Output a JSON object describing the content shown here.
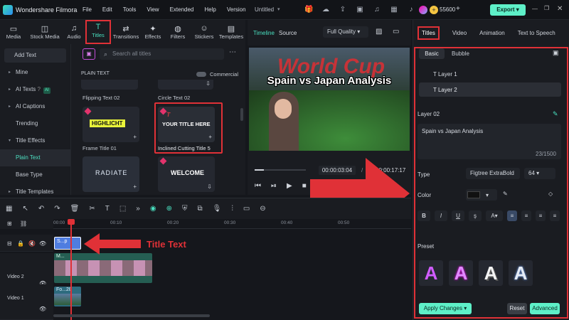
{
  "app": {
    "name": "Wondershare Filmora",
    "project": "Untitled",
    "credits": "55600",
    "export_label": "Export"
  },
  "menu": [
    "File",
    "Edit",
    "Tools",
    "View",
    "Extended",
    "Help",
    "Version"
  ],
  "toolbar": {
    "items": [
      {
        "label": "Media",
        "icon": "media-icon"
      },
      {
        "label": "Stock Media",
        "icon": "stock-media-icon"
      },
      {
        "label": "Audio",
        "icon": "audio-icon"
      },
      {
        "label": "Titles",
        "icon": "titles-icon"
      },
      {
        "label": "Transitions",
        "icon": "transitions-icon"
      },
      {
        "label": "Effects",
        "icon": "effects-icon"
      },
      {
        "label": "Filters",
        "icon": "filters-icon"
      },
      {
        "label": "Stickers",
        "icon": "stickers-icon"
      },
      {
        "label": "Templates",
        "icon": "templates-icon"
      }
    ]
  },
  "leftnav": {
    "add_text": "Add Text",
    "items": [
      "Mine",
      "AI Texts",
      "AI Captions",
      "Trending",
      "Title Effects",
      "Plain Text",
      "Base Type",
      "Title Templates"
    ],
    "ai_badge": "AI"
  },
  "grid": {
    "search_placeholder": "Search all titles",
    "section": "PLAIN TEXT",
    "commercial": "Commercial",
    "row0": [
      "Flipping Text 02",
      "Circle Text 02"
    ],
    "cards": [
      {
        "thumb": "HIGHLICHT",
        "label": "Frame Title 01"
      },
      {
        "thumb": "YOUR TITLE HERE",
        "label": "Inclined Cutting Title 5"
      },
      {
        "thumb": "RADIATE",
        "label": ""
      },
      {
        "thumb": "WELCOME",
        "label": ""
      }
    ]
  },
  "preview": {
    "tabs": [
      "Timeline",
      "Source"
    ],
    "quality": "Full Quality",
    "overlay_text": "Spain vs Japan Analysis",
    "time_current": "00:00:03:04",
    "time_total": "00:00:17:17",
    "progress": 0.18,
    "bg_text": "World Cup"
  },
  "right": {
    "tabs": [
      "Titles",
      "Video",
      "Animation",
      "Text to Speech"
    ],
    "subtabs": [
      "Basic",
      "Bubble"
    ],
    "layers": [
      "Layer 1",
      "Layer 2"
    ],
    "layer_label": "Layer 02",
    "text_value": "Spain vs Japan Analysis",
    "char_count": "23/1500",
    "type_label": "Type",
    "font": "Figtree ExtraBold",
    "size": "64",
    "color_label": "Color",
    "color_value": "#111111",
    "preset_label": "Preset",
    "apply_label": "Apply Changes",
    "reset_label": "Reset",
    "advanced_label": "Advanced"
  },
  "timeline": {
    "ruler": [
      "00:00",
      "00:00:00:10",
      "00:00:00:20",
      "00:00:00:30",
      "00:00:00:40",
      "00:00:00:50"
    ],
    "tracks": [
      "Video 2",
      "Video 1"
    ],
    "clip_title": "S...p",
    "clip_video2": "M...",
    "clip_video1": "Fo...28",
    "annotation": "Title Text"
  },
  "colors": {
    "accent": "#49e0c0",
    "highlight": "#e03137"
  }
}
